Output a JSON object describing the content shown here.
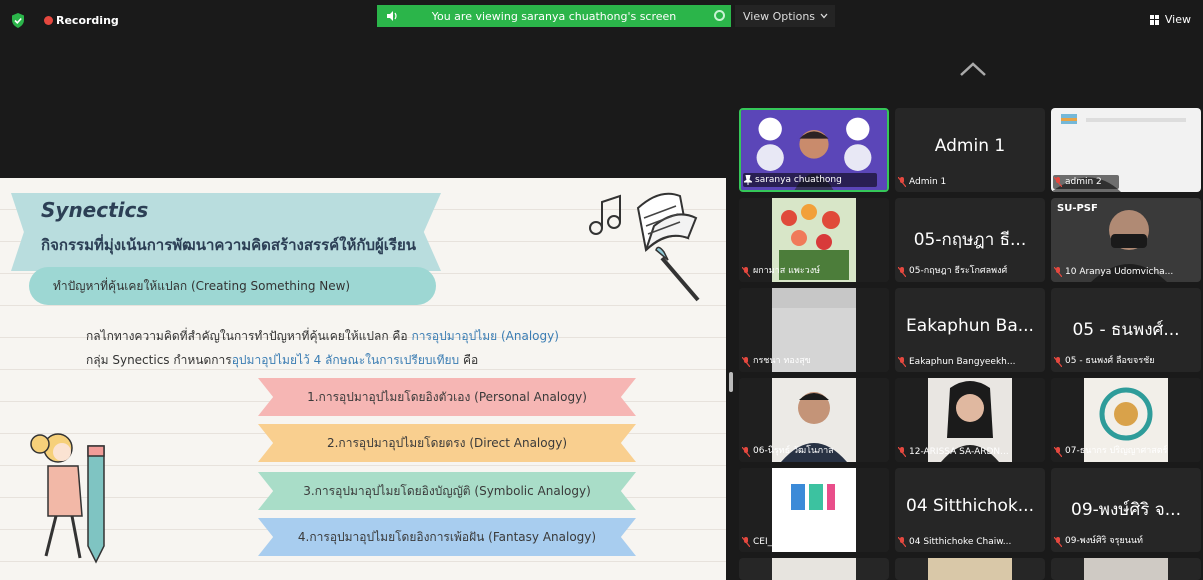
{
  "top_bar": {
    "recording_label": "Recording",
    "banner_text": "You are viewing saranya chuathong's screen",
    "view_options_label": "View Options",
    "view_label": "View",
    "colors": {
      "banner": "#2bb54a",
      "recording_dot": "#e5483f",
      "background": "#1a1a1a"
    }
  },
  "slide": {
    "title": "Synectics",
    "subtitle": "กิจกรรมที่มุ่งเน้นการพัฒนาความคิดสร้างสรรค์ให้กับผู้เรียน",
    "highlight_pill": "ทำปัญหาที่คุ้นเคยให้แปลก (Creating Something New)",
    "line1": {
      "text": "กลไกทางความคิดที่สำคัญในการทำปัญหาที่คุ้นเคยให้แปลก คือ ",
      "highlight": "การอุปมาอุปไมย (Analogy)"
    },
    "line2": {
      "prefix": "กลุ่ม Synectics กำหนดการ",
      "highlight": "อุปมาอุปไมยไว้  4 ลักษณะในการเปรียบเทียบ",
      "suffix": " คือ"
    },
    "analogies": [
      "1.การอุปมาอุปไมยโดยอิงตัวเอง (Personal Analogy)",
      "2.การอุปมาอุปไมยโดยตรง (Direct Analogy)",
      "3.การอุปมาอุปไมยโดยอิงบัญญัติ (Symbolic Analogy)",
      "4.การอุปมาอุปไมยโดยอิงการเพ้อฝัน (Fantasy Analogy)"
    ]
  },
  "gallery": {
    "tiles": [
      {
        "name": "saranya chuathong",
        "kind": "video-cartoon",
        "active": true
      },
      {
        "name": "Admin 1",
        "big": "Admin 1",
        "kind": "text"
      },
      {
        "name": "admin 2",
        "kind": "video-screen"
      },
      {
        "name": "ผกามาส แพะวงษ์",
        "kind": "video-flowers"
      },
      {
        "name": "05-กฤษฎา ธีระโกศลพงศ์",
        "big": "05-กฤษฎา ธี...",
        "kind": "text"
      },
      {
        "name": "10 Aranya Udomvicha...",
        "kind": "video-person-mask",
        "overlay": "SU-PSF"
      },
      {
        "name": "กรชนา ทองสุข",
        "kind": "video-wall"
      },
      {
        "name": "Eakaphun Bangyeekh...",
        "big": "Eakaphun Ba...",
        "kind": "text"
      },
      {
        "name": "05 - ธนพงศ์ ลือขจรชัย",
        "big": "05 - ธนพงศ์...",
        "kind": "text"
      },
      {
        "name": "06-นิรุทธ์ วัฒโนภาส",
        "kind": "video-man"
      },
      {
        "name": "12-ARISSA SA-ARDN...",
        "kind": "video-woman"
      },
      {
        "name": "07-ธนากร ปริญญาศาสตร์",
        "kind": "video-logo"
      },
      {
        "name": "CEI_SU",
        "kind": "video-cei"
      },
      {
        "name": "04 Sitthichoke Chaiw...",
        "big": "04 Sitthichok...",
        "kind": "text"
      },
      {
        "name": "09-พงษ์ศิริ จรุยนนท์",
        "big": "09-พงษ์ศิริ จ...",
        "kind": "text"
      }
    ]
  }
}
